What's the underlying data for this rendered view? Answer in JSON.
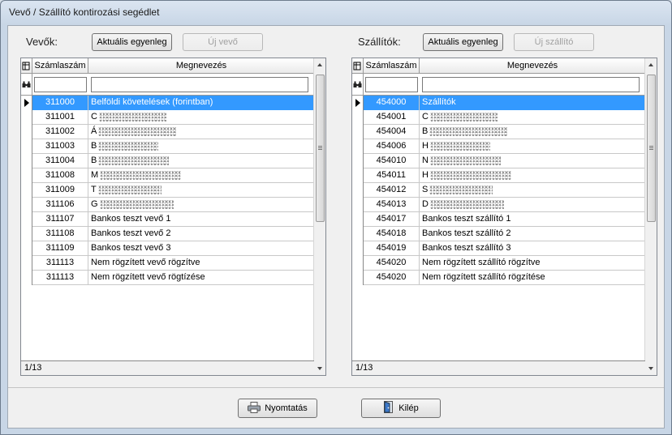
{
  "window": {
    "title": "Vevő / Szállító kontirozási segédlet"
  },
  "left_panel": {
    "label": "Vevők:",
    "balance_button": "Aktuális egyenleg",
    "new_button": "Új vevő",
    "columns": [
      "Számlaszám",
      "Megnevezés"
    ],
    "status": "1/13",
    "rows": [
      {
        "num": "311000",
        "name": "Belföldi követelések (forintban)",
        "blurred": false,
        "selected": true
      },
      {
        "num": "311001",
        "name": "C",
        "blurred": true,
        "selected": false
      },
      {
        "num": "311002",
        "name": "Á",
        "blurred": true,
        "selected": false
      },
      {
        "num": "311003",
        "name": "B",
        "blurred": true,
        "selected": false
      },
      {
        "num": "311004",
        "name": "B",
        "blurred": true,
        "selected": false
      },
      {
        "num": "311008",
        "name": "M",
        "blurred": true,
        "selected": false
      },
      {
        "num": "311009",
        "name": "T",
        "blurred": true,
        "selected": false
      },
      {
        "num": "311106",
        "name": "G",
        "blurred": true,
        "selected": false
      },
      {
        "num": "311107",
        "name": "Bankos teszt vevő 1",
        "blurred": false,
        "selected": false
      },
      {
        "num": "311108",
        "name": "Bankos teszt vevő 2",
        "blurred": false,
        "selected": false
      },
      {
        "num": "311109",
        "name": "Bankos teszt vevő 3",
        "blurred": false,
        "selected": false
      },
      {
        "num": "311113",
        "name": "Nem rögzített vevő rögzítve",
        "blurred": false,
        "selected": false
      },
      {
        "num": "311113",
        "name": "Nem rögzített vevő rögtízése",
        "blurred": false,
        "selected": false
      }
    ]
  },
  "right_panel": {
    "label": "Szállítók:",
    "balance_button": "Aktuális egyenleg",
    "new_button": "Új szállító",
    "columns": [
      "Számlaszám",
      "Megnevezés"
    ],
    "status": "1/13",
    "rows": [
      {
        "num": "454000",
        "name": "Szállítók",
        "blurred": false,
        "selected": true
      },
      {
        "num": "454001",
        "name": "C",
        "blurred": true,
        "selected": false
      },
      {
        "num": "454004",
        "name": "B",
        "blurred": true,
        "selected": false
      },
      {
        "num": "454006",
        "name": "H",
        "blurred": true,
        "selected": false
      },
      {
        "num": "454010",
        "name": "N",
        "blurred": true,
        "selected": false
      },
      {
        "num": "454011",
        "name": "H",
        "blurred": true,
        "selected": false
      },
      {
        "num": "454012",
        "name": "S",
        "blurred": true,
        "selected": false
      },
      {
        "num": "454013",
        "name": "D",
        "blurred": true,
        "selected": false
      },
      {
        "num": "454017",
        "name": "Bankos teszt szállító 1",
        "blurred": false,
        "selected": false
      },
      {
        "num": "454018",
        "name": "Bankos teszt szállító 2",
        "blurred": false,
        "selected": false
      },
      {
        "num": "454019",
        "name": "Bankos teszt szállító 3",
        "blurred": false,
        "selected": false
      },
      {
        "num": "454020",
        "name": "Nem rögzített szállító rögzítve",
        "blurred": false,
        "selected": false
      },
      {
        "num": "454020",
        "name": "Nem rögzített szállító rögzítése",
        "blurred": false,
        "selected": false
      }
    ]
  },
  "footer": {
    "print_button": "Nyomtatás",
    "exit_button": "Kilép"
  },
  "icons": {
    "header_corner": "grid-settings-icon",
    "filter_row": "binoculars-icon",
    "print": "printer-icon",
    "exit": "exit-door-icon",
    "row_indicator": "current-row-arrow-icon"
  },
  "colors": {
    "selection": "#3399ff",
    "window_frame": "#c8d6e6"
  }
}
